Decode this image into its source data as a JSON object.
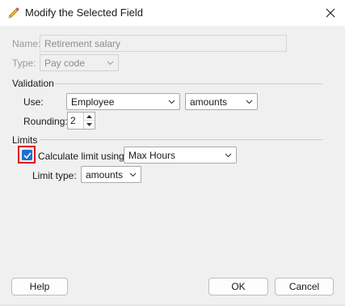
{
  "window": {
    "title": "Modify the Selected Field"
  },
  "name_field": {
    "label": "Name:",
    "value": "Retirement salary"
  },
  "type_field": {
    "label": "Type:",
    "value": "Pay code"
  },
  "validation": {
    "group_label": "Validation",
    "use_label": "Use:",
    "use_value": "Employee",
    "use_unit_value": "amounts",
    "rounding_label": "Rounding:",
    "rounding_value": "2"
  },
  "limits": {
    "group_label": "Limits",
    "calculate_label": "Calculate limit using:",
    "calculate_checked": true,
    "calculate_value": "Max Hours",
    "limit_type_label": "Limit type:",
    "limit_type_value": "amounts"
  },
  "buttons": {
    "help": "Help",
    "ok": "OK",
    "cancel": "Cancel"
  },
  "colors": {
    "accent": "#1f6fd0",
    "highlight": "#e0141e"
  }
}
